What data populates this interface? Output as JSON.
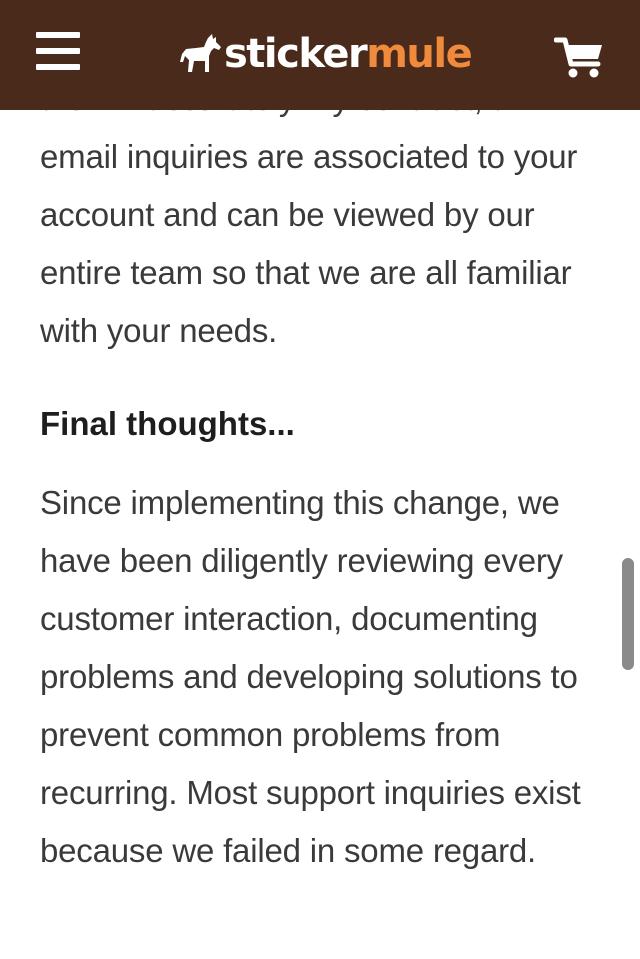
{
  "header": {
    "brand": {
      "part1": "sticker",
      "part2": "mule",
      "icon": "mule-icon"
    },
    "menu_icon": "hamburger-menu-icon",
    "cart_icon": "shopping-cart-icon",
    "colors": {
      "bar": "#4a2a1a",
      "brand_accent": "#f08a3c",
      "brand_white": "#ffffff"
    }
  },
  "article": {
    "paragraph_1": "them inaccurately. By contrast, all email inquiries are associated to your account and can be viewed by our entire team so that we are all familiar with your needs.",
    "heading": "Final thoughts...",
    "paragraph_2": "Since implementing this change, we have been diligently reviewing every customer interaction, documenting problems and developing solutions to prevent common problems from recurring. Most support inquiries exist because we failed in some regard."
  }
}
